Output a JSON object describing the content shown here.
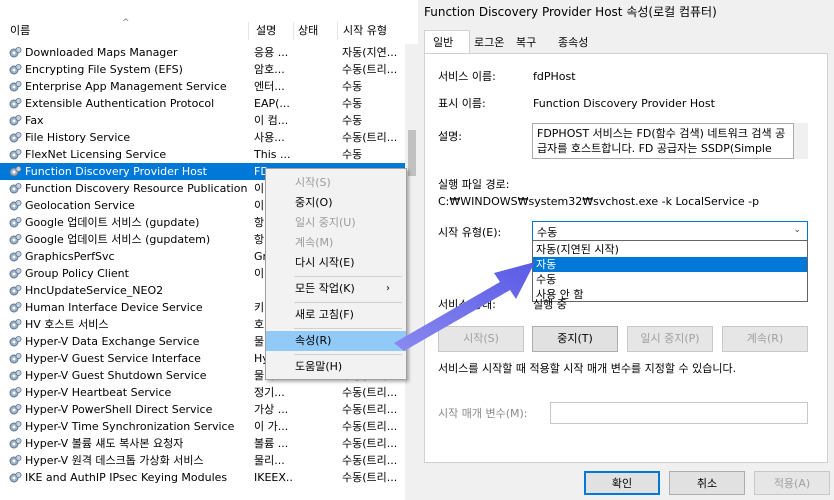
{
  "services": {
    "columns": [
      "이름",
      "설명",
      "상태",
      "시작 유형"
    ],
    "rows": [
      {
        "name": "Downloaded Maps Manager",
        "desc": "응용 ...",
        "status": "",
        "type": "자동(지연..."
      },
      {
        "name": "Encrypting File System (EFS)",
        "desc": "암호...",
        "status": "",
        "type": "수동(트리..."
      },
      {
        "name": "Enterprise App Management Service",
        "desc": "엔터...",
        "status": "",
        "type": "수동"
      },
      {
        "name": "Extensible Authentication Protocol",
        "desc": "EAP(...",
        "status": "",
        "type": "수동"
      },
      {
        "name": "Fax",
        "desc": "이 컴...",
        "status": "",
        "type": "수동"
      },
      {
        "name": "File History Service",
        "desc": "사용...",
        "status": "",
        "type": "수동(트리..."
      },
      {
        "name": "FlexNet Licensing Service",
        "desc": "This ...",
        "status": "",
        "type": "수동"
      },
      {
        "name": "Function Discovery Provider Host",
        "desc": "FD...",
        "status": "",
        "type": ""
      },
      {
        "name": "Function Discovery Resource Publication",
        "desc": "이",
        "status": "",
        "type": ""
      },
      {
        "name": "Geolocation Service",
        "desc": "이",
        "status": "",
        "type": ""
      },
      {
        "name": "Google 업데이트 서비스 (gupdate)",
        "desc": "항",
        "status": "",
        "type": ""
      },
      {
        "name": "Google 업데이트 서비스 (gupdatem)",
        "desc": "항",
        "status": "",
        "type": ""
      },
      {
        "name": "GraphicsPerfSvc",
        "desc": "Gr",
        "status": "",
        "type": ""
      },
      {
        "name": "Group Policy Client",
        "desc": "이",
        "status": "",
        "type": ""
      },
      {
        "name": "HncUpdateService_NEO2",
        "desc": "",
        "status": "",
        "type": ""
      },
      {
        "name": "Human Interface Device Service",
        "desc": "키",
        "status": "",
        "type": ""
      },
      {
        "name": "HV 호스트 서비스",
        "desc": "호",
        "status": "",
        "type": ""
      },
      {
        "name": "Hyper-V Data Exchange Service",
        "desc": "물",
        "status": "",
        "type": ""
      },
      {
        "name": "Hyper-V Guest Service Interface",
        "desc": "Hy",
        "status": "",
        "type": ""
      },
      {
        "name": "Hyper-V Guest Shutdown Service",
        "desc": "물리...",
        "status": "",
        "type": "수동(트리..."
      },
      {
        "name": "Hyper-V Heartbeat Service",
        "desc": "정기...",
        "status": "",
        "type": "수동(트리..."
      },
      {
        "name": "Hyper-V PowerShell Direct Service",
        "desc": "가상 ...",
        "status": "",
        "type": "수동(트리..."
      },
      {
        "name": "Hyper-V Time Synchronization Service",
        "desc": "이 가...",
        "status": "",
        "type": "수동(트리..."
      },
      {
        "name": "Hyper-V 볼륨 섀도 복사본 요청자",
        "desc": "볼륨 ...",
        "status": "",
        "type": "수동(트리..."
      },
      {
        "name": "Hyper-V 원격 데스크톱 가상화 서비스",
        "desc": "물리...",
        "status": "",
        "type": "수동(트리..."
      },
      {
        "name": "IKE and AuthIP IPsec Keying Modules",
        "desc": "IKEEX...",
        "status": "",
        "type": "수동(트리..."
      }
    ],
    "selected_index": 7
  },
  "context_menu": {
    "items": [
      {
        "label": "시작(S)",
        "disabled": true
      },
      {
        "label": "중지(O)",
        "disabled": false
      },
      {
        "label": "일시 중지(U)",
        "disabled": true
      },
      {
        "label": "계속(M)",
        "disabled": true
      },
      {
        "label": "다시 시작(E)",
        "disabled": false
      },
      {
        "label": "모든 작업(K)",
        "disabled": false,
        "submenu": true
      },
      {
        "label": "새로 고침(F)",
        "disabled": false
      },
      {
        "label": "속성(R)",
        "disabled": false,
        "highlighted": true
      },
      {
        "label": "도움말(H)",
        "disabled": false
      }
    ]
  },
  "dialog": {
    "title": "Function Discovery Provider Host 속성(로컬 컴퓨터)",
    "tabs": [
      "일반",
      "로그온",
      "복구",
      "종속성"
    ],
    "service_name_label": "서비스 이름:",
    "service_name": "fdPHost",
    "display_name_label": "표시 이름:",
    "display_name": "Function Discovery Provider Host",
    "description_label": "설명:",
    "description": "FDPHOST 서비스는 FD(함수 검색) 네트워크 검색 공급자를 호스트합니다. FD 공급자는 SSDP(Simple Services",
    "exe_path_label": "실행 파일 경로:",
    "exe_path": "C:₩WINDOWS₩system32₩svchost.exe -k LocalService -p",
    "startup_type_label": "시작 유형(E):",
    "startup_type_value": "수동",
    "startup_options": [
      "자동(지연된 시작)",
      "자동",
      "수동",
      "사용 안 함"
    ],
    "startup_highlight_index": 1,
    "status_label": "서비스 상태:",
    "status_value": "실행 중",
    "buttons": {
      "start": "시작(S)",
      "stop": "중지(T)",
      "pause": "일시 중지(P)",
      "resume": "계속(R)"
    },
    "hint": "서비스를 시작할 때 적용할 시작 매개 변수를 지정할 수 있습니다.",
    "param_label": "시작 매개 변수(M):",
    "footer": {
      "ok": "확인",
      "cancel": "취소",
      "apply": "적용(A)"
    }
  },
  "colors": {
    "selection": "#0078d7",
    "arrow": "#6b6bea",
    "menu_highlight": "#91c9f7"
  }
}
